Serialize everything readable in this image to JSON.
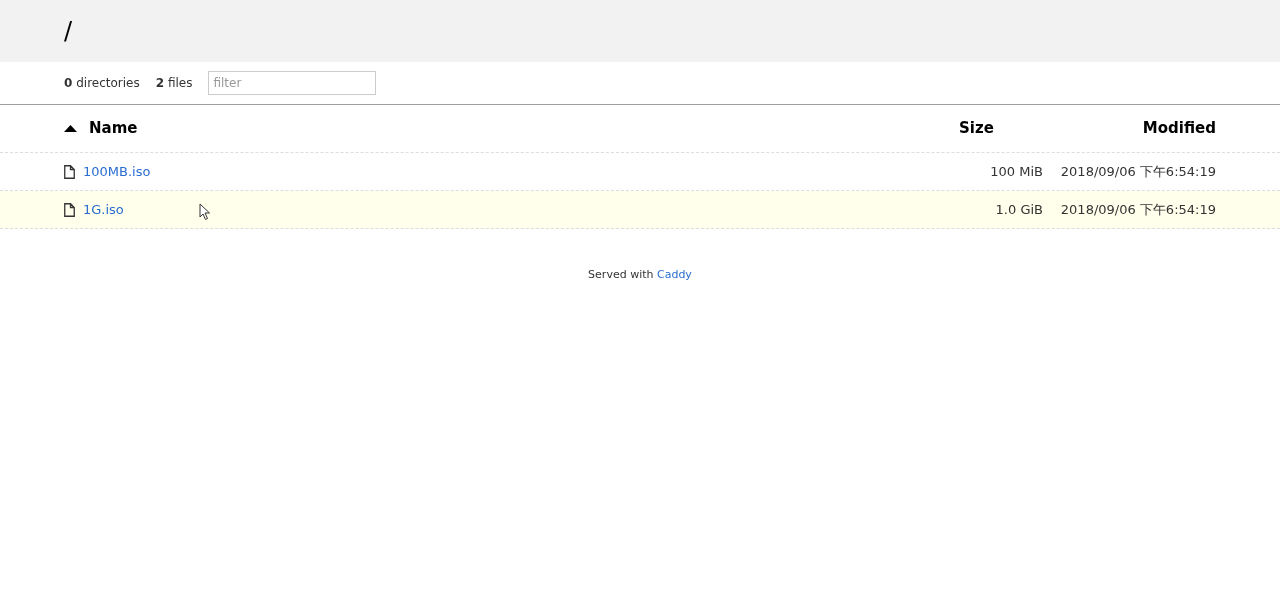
{
  "header": {
    "path": "/"
  },
  "summary": {
    "directories_count": "0",
    "directories_label": "directories",
    "files_count": "2",
    "files_label": "files"
  },
  "filter": {
    "placeholder": "filter"
  },
  "table": {
    "columns": [
      {
        "label": "Name",
        "sorted": true
      },
      {
        "label": "Size",
        "sorted": false
      },
      {
        "label": "Modified",
        "sorted": false
      }
    ],
    "rows": [
      {
        "name": "100MB.iso",
        "size": "100 MiB",
        "modified": "2018/09/06 下午6:54:19",
        "highlighted": false
      },
      {
        "name": "1G.iso",
        "size": "1.0 GiB",
        "modified": "2018/09/06 下午6:54:19",
        "highlighted": true
      }
    ]
  },
  "footer": {
    "text": "Served with",
    "link": "Caddy"
  }
}
